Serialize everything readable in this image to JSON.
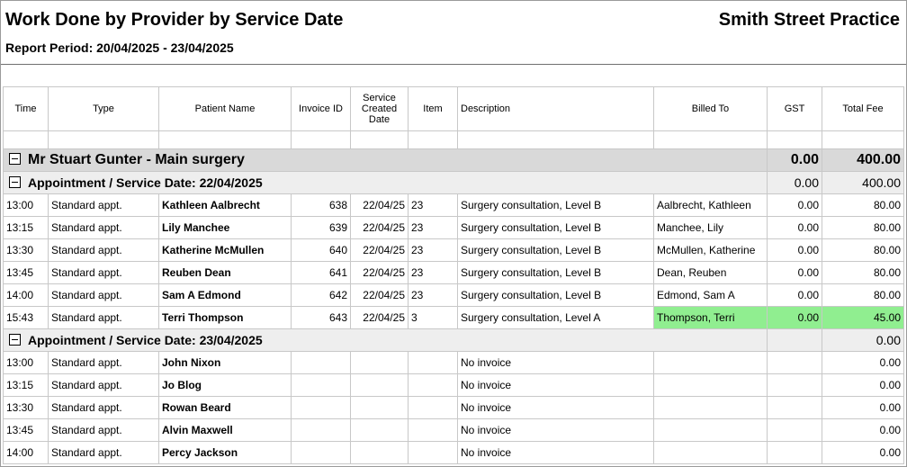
{
  "header": {
    "title": "Work Done by Provider by Service Date",
    "practice": "Smith Street Practice",
    "period": "Report Period: 20/04/2025 - 23/04/2025"
  },
  "columns": [
    "Time",
    "Type",
    "Patient Name",
    "Invoice ID",
    "Service Created Date",
    "Item",
    "Description",
    "Billed To",
    "GST",
    "Total Fee"
  ],
  "provider": {
    "label": "Mr Stuart Gunter - Main surgery",
    "gst": "0.00",
    "total": "400.00"
  },
  "groups": [
    {
      "label": "Appointment / Service Date: 22/04/2025",
      "gst": "0.00",
      "total": "400.00",
      "rows": [
        {
          "time": "13:00",
          "type": "Standard appt.",
          "patient": "Kathleen Aalbrecht",
          "invoice": "638",
          "date": "22/04/25",
          "item": "23",
          "description": "Surgery consultation, Level B",
          "billed": "Aalbrecht, Kathleen",
          "gst": "0.00",
          "fee": "80.00"
        },
        {
          "time": "13:15",
          "type": "Standard appt.",
          "patient": "Lily Manchee",
          "invoice": "639",
          "date": "22/04/25",
          "item": "23",
          "description": "Surgery consultation, Level B",
          "billed": "Manchee, Lily",
          "gst": "0.00",
          "fee": "80.00"
        },
        {
          "time": "13:30",
          "type": "Standard appt.",
          "patient": "Katherine McMullen",
          "invoice": "640",
          "date": "22/04/25",
          "item": "23",
          "description": "Surgery consultation, Level B",
          "billed": "McMullen, Katherine",
          "gst": "0.00",
          "fee": "80.00"
        },
        {
          "time": "13:45",
          "type": "Standard appt.",
          "patient": "Reuben Dean",
          "invoice": "641",
          "date": "22/04/25",
          "item": "23",
          "description": "Surgery consultation, Level B",
          "billed": "Dean, Reuben",
          "gst": "0.00",
          "fee": "80.00"
        },
        {
          "time": "14:00",
          "type": "Standard appt.",
          "patient": "Sam A Edmond",
          "invoice": "642",
          "date": "22/04/25",
          "item": "23",
          "description": "Surgery consultation, Level B",
          "billed": "Edmond, Sam A",
          "gst": "0.00",
          "fee": "80.00"
        },
        {
          "time": "15:43",
          "type": "Standard appt.",
          "patient": "Terri Thompson",
          "invoice": "643",
          "date": "22/04/25",
          "item": "3",
          "description": "Surgery consultation, Level A",
          "billed": "Thompson, Terri",
          "gst": "0.00",
          "fee": "45.00",
          "highlight": "#90ee90"
        }
      ]
    },
    {
      "label": "Appointment / Service Date: 23/04/2025",
      "gst": "",
      "total": "0.00",
      "rows": [
        {
          "time": "13:00",
          "type": "Standard appt.",
          "patient": "John Nixon",
          "invoice": "",
          "date": "",
          "item": "",
          "description": "No invoice",
          "billed": "",
          "gst": "",
          "fee": "0.00"
        },
        {
          "time": "13:15",
          "type": "Standard appt.",
          "patient": "Jo Blog",
          "invoice": "",
          "date": "",
          "item": "",
          "description": "No invoice",
          "billed": "",
          "gst": "",
          "fee": "0.00"
        },
        {
          "time": "13:30",
          "type": "Standard appt.",
          "patient": "Rowan Beard",
          "invoice": "",
          "date": "",
          "item": "",
          "description": "No invoice",
          "billed": "",
          "gst": "",
          "fee": "0.00"
        },
        {
          "time": "13:45",
          "type": "Standard appt.",
          "patient": "Alvin Maxwell",
          "invoice": "",
          "date": "",
          "item": "",
          "description": "No invoice",
          "billed": "",
          "gst": "",
          "fee": "0.00"
        },
        {
          "time": "14:00",
          "type": "Standard appt.",
          "patient": "Percy Jackson",
          "invoice": "",
          "date": "",
          "item": "",
          "description": "No invoice",
          "billed": "",
          "gst": "",
          "fee": "0.00"
        }
      ]
    }
  ]
}
